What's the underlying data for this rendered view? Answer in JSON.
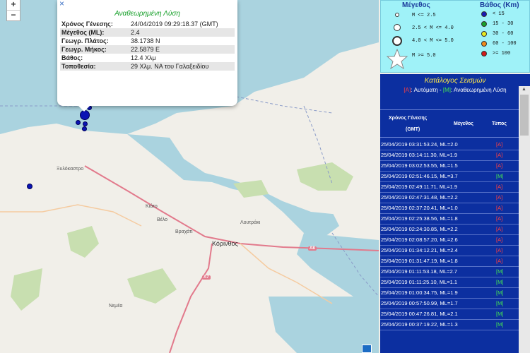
{
  "map": {
    "zoom_in": "+",
    "zoom_out": "−",
    "towns": [
      {
        "name": "Ξυλόκαστρο",
        "big": false
      },
      {
        "name": "Κιάτο",
        "big": false
      },
      {
        "name": "Βέλο",
        "big": false
      },
      {
        "name": "Βραχάτι",
        "big": false
      },
      {
        "name": "Κόρινθος",
        "big": true
      },
      {
        "name": "Λουτράκι",
        "big": false
      },
      {
        "name": "Νεμέα",
        "big": false
      }
    ],
    "roads": [
      "A8",
      "A7"
    ],
    "quakes_count": 6
  },
  "popup": {
    "close": "×",
    "title": "Αναθεωρημένη Λύση",
    "rows": [
      {
        "k": "Χρόνος Γένεσης:",
        "v": "24/04/2019 09:29:18.37 (GMT)"
      },
      {
        "k": "Μέγεθος (ML):",
        "v": "2.4"
      },
      {
        "k": "Γεωγρ. Πλάτος:",
        "v": "38.1738 N"
      },
      {
        "k": "Γεωγρ. Μήκος:",
        "v": "22.5879 E"
      },
      {
        "k": "Βάθος:",
        "v": "12.4 Χλμ"
      },
      {
        "k": "Τοποθεσία:",
        "v": "29 Χλμ. ΝΑ του Γαλαξειδίου"
      }
    ]
  },
  "legend": {
    "magnitude_title": "Μέγεθος",
    "depth_title": "Βάθος (Km)",
    "magnitudes": [
      "M <= 2.5",
      "2.5 < M <= 4.0",
      "4.0 < M <= 5.0",
      "M >= 5.0"
    ],
    "depths": [
      {
        "label": "< 15",
        "color": "#1a1ab4"
      },
      {
        "label": "15 - 30",
        "color": "#1aa02a"
      },
      {
        "label": "30 - 60",
        "color": "#e8e820"
      },
      {
        "label": "60 - 100",
        "color": "#f08a1a"
      },
      {
        "label": ">= 100",
        "color": "#d21a1a"
      }
    ]
  },
  "catalog": {
    "title": "Κατάλογος Σεισμών",
    "auto_tag": "[A]",
    "auto_label": ": Αυτόματη - ",
    "rev_tag": "[M]",
    "rev_label": ": Αναθεωρημένη Λύση",
    "col_time": "Χρόνος Γένεσης",
    "col_time2": "(GMT)",
    "col_mag": "Μέγεθος",
    "col_type": "Τύπος",
    "rows": [
      {
        "t": "25/04/2019 03:31:53.24, ML=2.0",
        "ty": "[A]"
      },
      {
        "t": "25/04/2019 03:14:11.30, ML=1.9",
        "ty": "[A]"
      },
      {
        "t": "25/04/2019 03:02:53.55, ML=1.5",
        "ty": "[A]"
      },
      {
        "t": "25/04/2019 02:51:46.15, ML=3.7",
        "ty": "[M]"
      },
      {
        "t": "25/04/2019 02:49:11.71, ML=1.9",
        "ty": "[A]"
      },
      {
        "t": "25/04/2019 02:47:31.48, ML=2.2",
        "ty": "[A]"
      },
      {
        "t": "25/04/2019 02:37:20.41, ML=1.0",
        "ty": "[A]"
      },
      {
        "t": "25/04/2019 02:25:38.56, ML=1.8",
        "ty": "[A]"
      },
      {
        "t": "25/04/2019 02:24:30.85, ML=2.2",
        "ty": "[A]"
      },
      {
        "t": "25/04/2019 02:08:57.20, ML=2.6",
        "ty": "[A]"
      },
      {
        "t": "25/04/2019 01:34:12.21, ML=2.4",
        "ty": "[A]"
      },
      {
        "t": "25/04/2019 01:31:47.19, ML=1.8",
        "ty": "[A]"
      },
      {
        "t": "25/04/2019 01:11:53.18, ML=2.7",
        "ty": "[M]"
      },
      {
        "t": "25/04/2019 01:11:25.10, ML=1.1",
        "ty": "[M]"
      },
      {
        "t": "25/04/2019 01:00:34.75, ML=1.9",
        "ty": "[M]"
      },
      {
        "t": "25/04/2019 00:57:50.99, ML=1.7",
        "ty": "[M]"
      },
      {
        "t": "25/04/2019 00:47:26.81, ML=2.1",
        "ty": "[M]"
      },
      {
        "t": "25/04/2019 00:37:19.22, ML=1.3",
        "ty": "[M]"
      }
    ]
  }
}
